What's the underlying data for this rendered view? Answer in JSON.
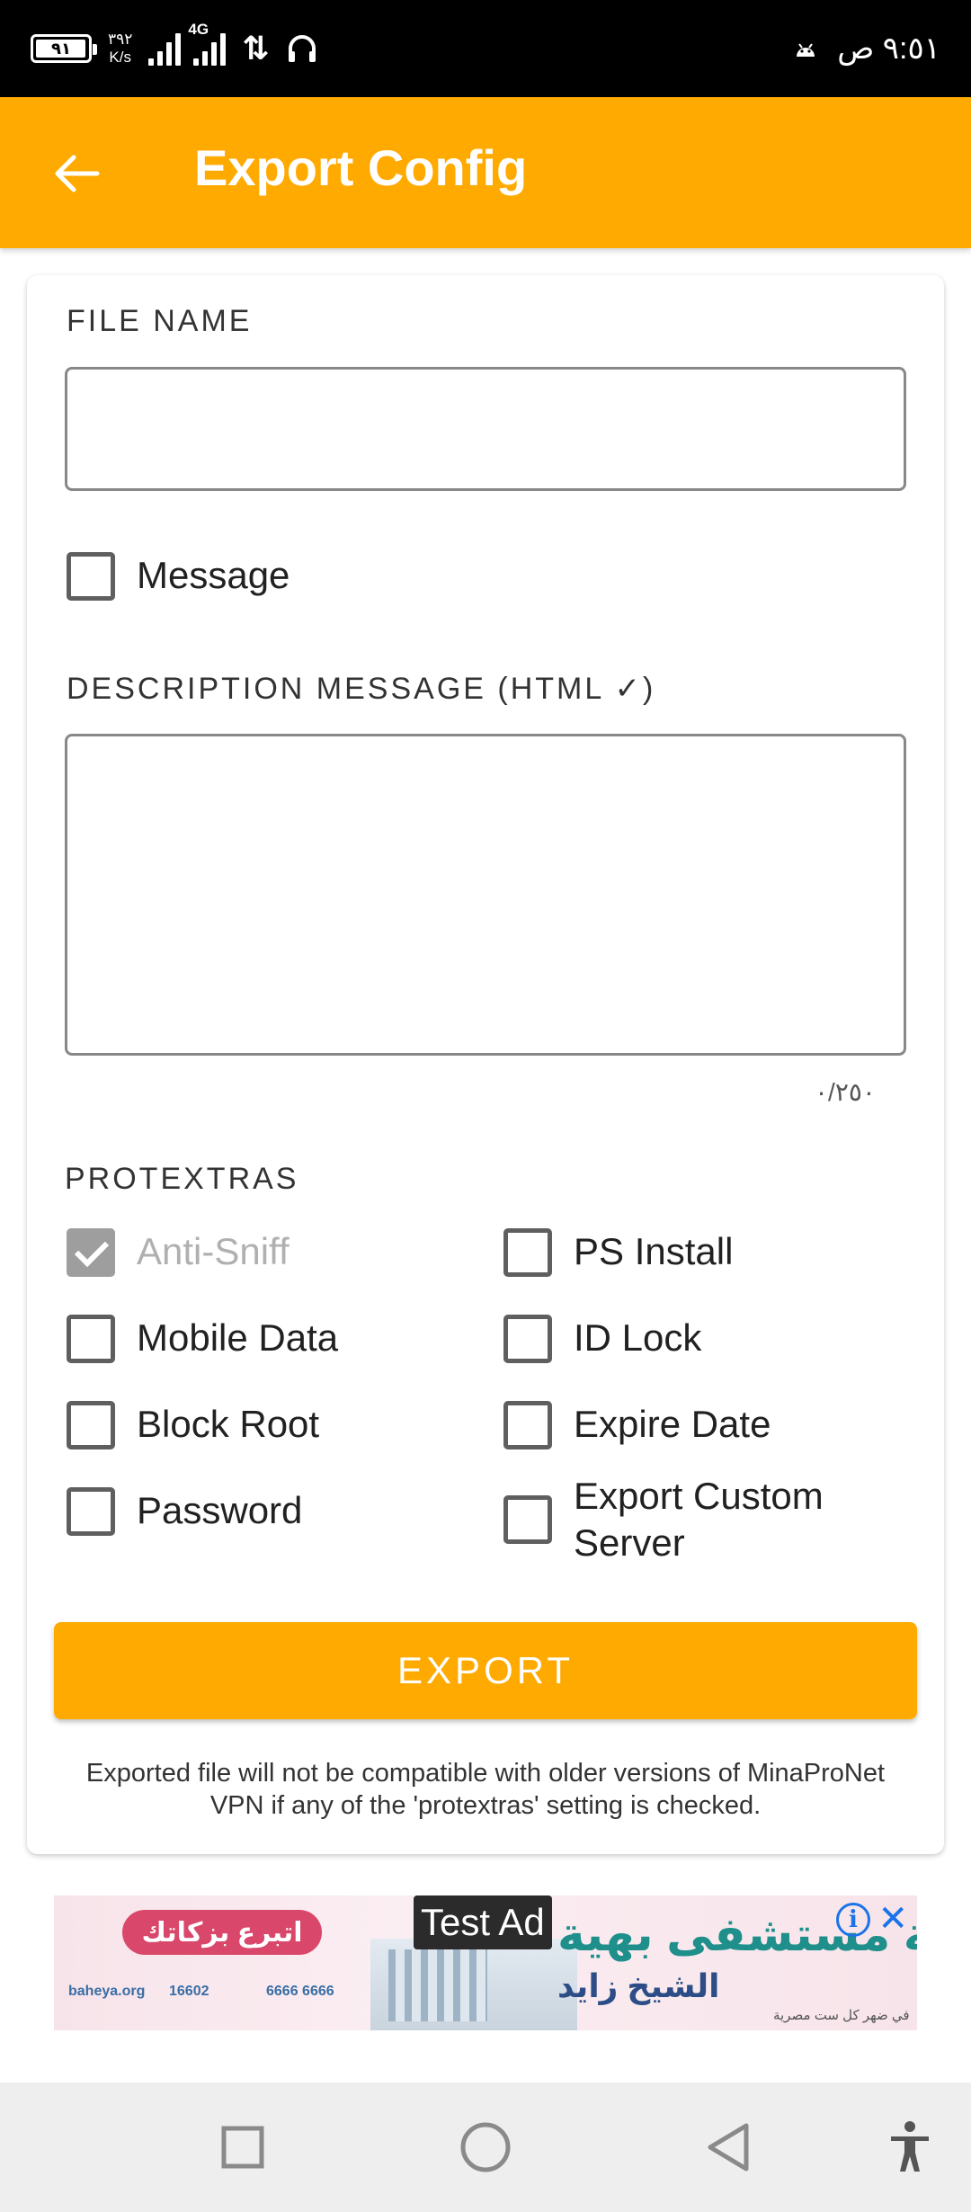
{
  "status_bar": {
    "battery": "٩١",
    "battery_level": 0.91,
    "net_speed_value": "٣٩٢",
    "net_speed_unit": "K/s",
    "network_type": "4G",
    "time": "٩:٥١ ص"
  },
  "app_bar": {
    "title": "Export Config",
    "back_icon": "arrow-left-icon"
  },
  "form": {
    "file_name_label": "FILE NAME",
    "file_name_value": "",
    "message_checkbox": {
      "label": "Message",
      "checked": false
    },
    "description_label": "DESCRIPTION MESSAGE (HTML ✓)",
    "description_value": "",
    "char_counter": "٠/٢٥٠",
    "protextras_label": "PROTEXTRAS",
    "protextras": [
      {
        "label": "Anti-Sniff",
        "checked": true,
        "disabled": true
      },
      {
        "label": "PS Install",
        "checked": false
      },
      {
        "label": "Mobile Data",
        "checked": false
      },
      {
        "label": "ID Lock",
        "checked": false
      },
      {
        "label": "Block Root",
        "checked": false
      },
      {
        "label": "Expire Date",
        "checked": false
      },
      {
        "label": "Password",
        "checked": false
      },
      {
        "label": "Export Custom Server",
        "checked": false
      }
    ],
    "export_button": "EXPORT",
    "note": "Exported file will not be compatible with older versions of MinaProNet VPN if any of the 'protextras' setting is checked."
  },
  "ad": {
    "tag": "Test Ad",
    "pill": "اتبرع بزكاتك",
    "headline": "بهية مستشفى بهية",
    "subheadline": "الشيخ زايد",
    "phone1": "6666 6666",
    "phone2": "16602",
    "site": "baheya.org",
    "footer": "في ضهر كل ست مصرية"
  },
  "colors": {
    "accent": "#FFAA00",
    "status_bar": "#000000",
    "nav_bar": "#eeeeee"
  },
  "nav_bar": {
    "icons": [
      "recents-square-icon",
      "home-circle-icon",
      "back-triangle-icon",
      "accessibility-icon"
    ]
  }
}
